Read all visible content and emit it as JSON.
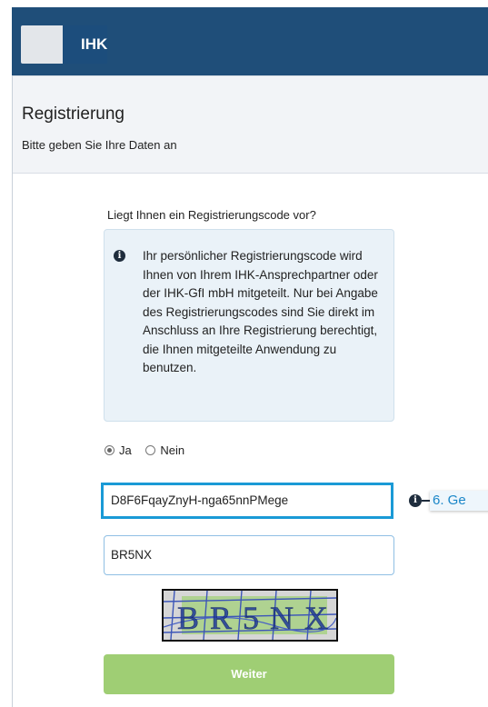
{
  "header": {
    "logo_text": "IHK"
  },
  "page": {
    "title": "Registrierung",
    "subtitle": "Bitte geben Sie Ihre Daten an"
  },
  "form": {
    "question": "Liegt Ihnen ein Registrierungscode vor?",
    "info_text": "Ihr persönlicher Registrierungscode wird Ihnen von Ihrem IHK-Ansprechpartner oder der IHK-GfI mbH mitgeteilt. Nur bei Angabe des Registrierungscodes sind Sie direkt im Anschluss an Ihre Registrierung berechtigt, die Ihnen mitgeteilte Anwendung zu benutzen.",
    "radio_yes": "Ja",
    "radio_no": "Nein",
    "selected": "Ja",
    "code_value": "D8F6FqayZnyH-nga65nnPMege",
    "hint_label": "6. Ge",
    "captcha_value": "BR5NX",
    "captcha_image_text": "BR5NX",
    "submit_label": "Weiter"
  },
  "colors": {
    "header_bg": "#1f4e79",
    "accent": "#1a9ad6",
    "submit_bg": "#9fce74"
  }
}
